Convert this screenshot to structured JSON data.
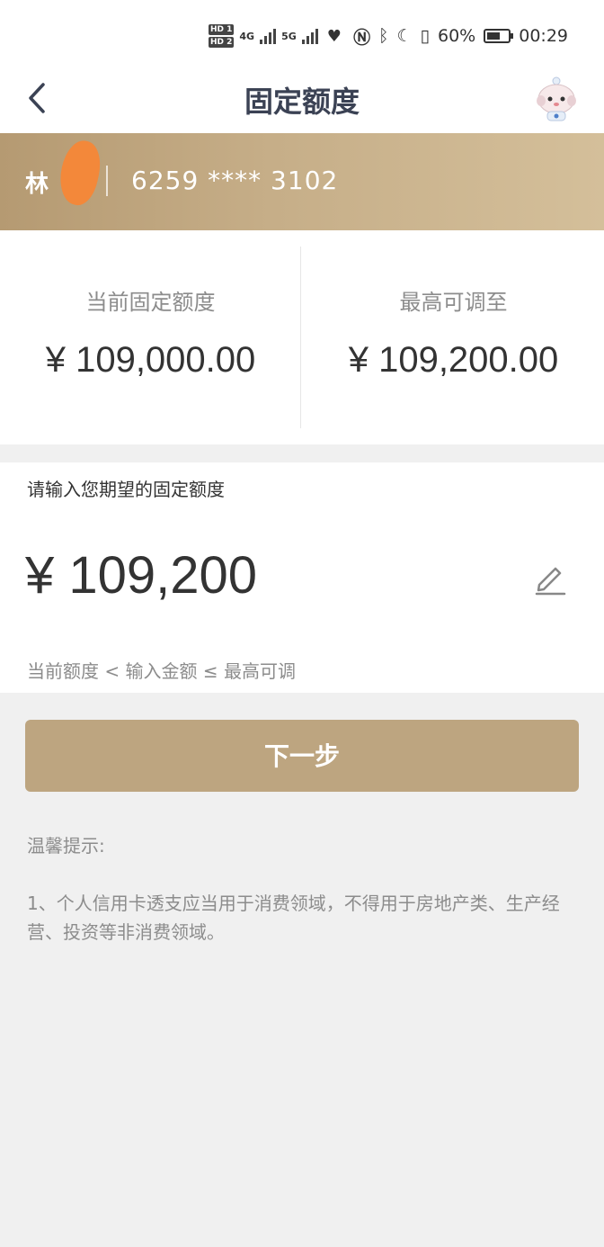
{
  "status_bar": {
    "hd1": "HD 1",
    "hd2": "HD 2",
    "net1": "4G",
    "net2": "5G",
    "battery_percent": "60%",
    "time": "00:29"
  },
  "nav": {
    "title": "固定额度"
  },
  "card": {
    "holder_name": "林",
    "number": "6259 **** 3102"
  },
  "limits": {
    "current_label": "当前固定额度",
    "current_value": "¥ 109,000.00",
    "max_label": "最高可调至",
    "max_value": "¥ 109,200.00"
  },
  "input": {
    "prompt": "请输入您期望的固定额度",
    "amount": "¥ 109,200",
    "hint": "当前额度 < 输入金额 ≤ 最高可调"
  },
  "actions": {
    "next_label": "下一步"
  },
  "tips": {
    "title": "温馨提示:",
    "items": [
      "1、个人信用卡透支应当用于消费领域，不得用于房地产类、生产经营、投资等非消费领域。"
    ]
  },
  "colors": {
    "accent": "#bda580",
    "banner_start": "#b59a72",
    "banner_end": "#d4bf9a",
    "redaction": "#f3883a"
  }
}
